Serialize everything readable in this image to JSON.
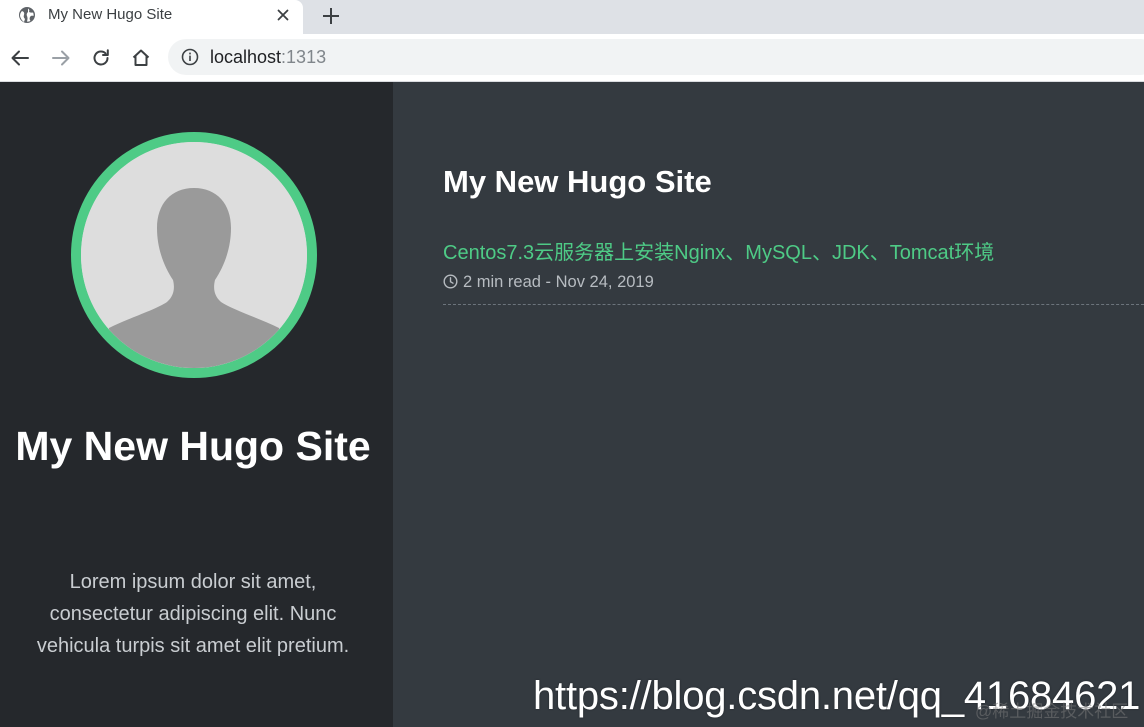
{
  "browser": {
    "tab": {
      "title": "My New Hugo Site",
      "icon": "globe-icon"
    },
    "new_tab_icon": "plus-icon",
    "nav": {
      "back_icon": "arrow-left-icon",
      "forward_icon": "arrow-right-icon",
      "reload_icon": "reload-icon",
      "home_icon": "home-icon"
    },
    "address": {
      "host": "localhost",
      "port": ":1313",
      "icon": "info-icon"
    }
  },
  "sidebar": {
    "avatar_icon": "user-avatar-placeholder",
    "title": "My New Hugo Site",
    "description": "Lorem ipsum dolor sit amet, consectetur adipiscing elit. Nunc vehicula turpis sit amet elit pretium."
  },
  "main": {
    "title": "My New Hugo Site",
    "posts": [
      {
        "title": "Centos7.3云服务器上安装Nginx、MySQL、JDK、Tomcat环境",
        "meta": "2 min read - Nov 24, 2019",
        "meta_icon": "clock-icon"
      }
    ]
  },
  "watermark": {
    "url": "https://blog.csdn.net/qq_41684621",
    "sub": "@稀土掘金技术社区"
  },
  "colors": {
    "accent": "#4ecb86",
    "sidebar_bg": "#25282c",
    "main_bg": "#343a40"
  }
}
